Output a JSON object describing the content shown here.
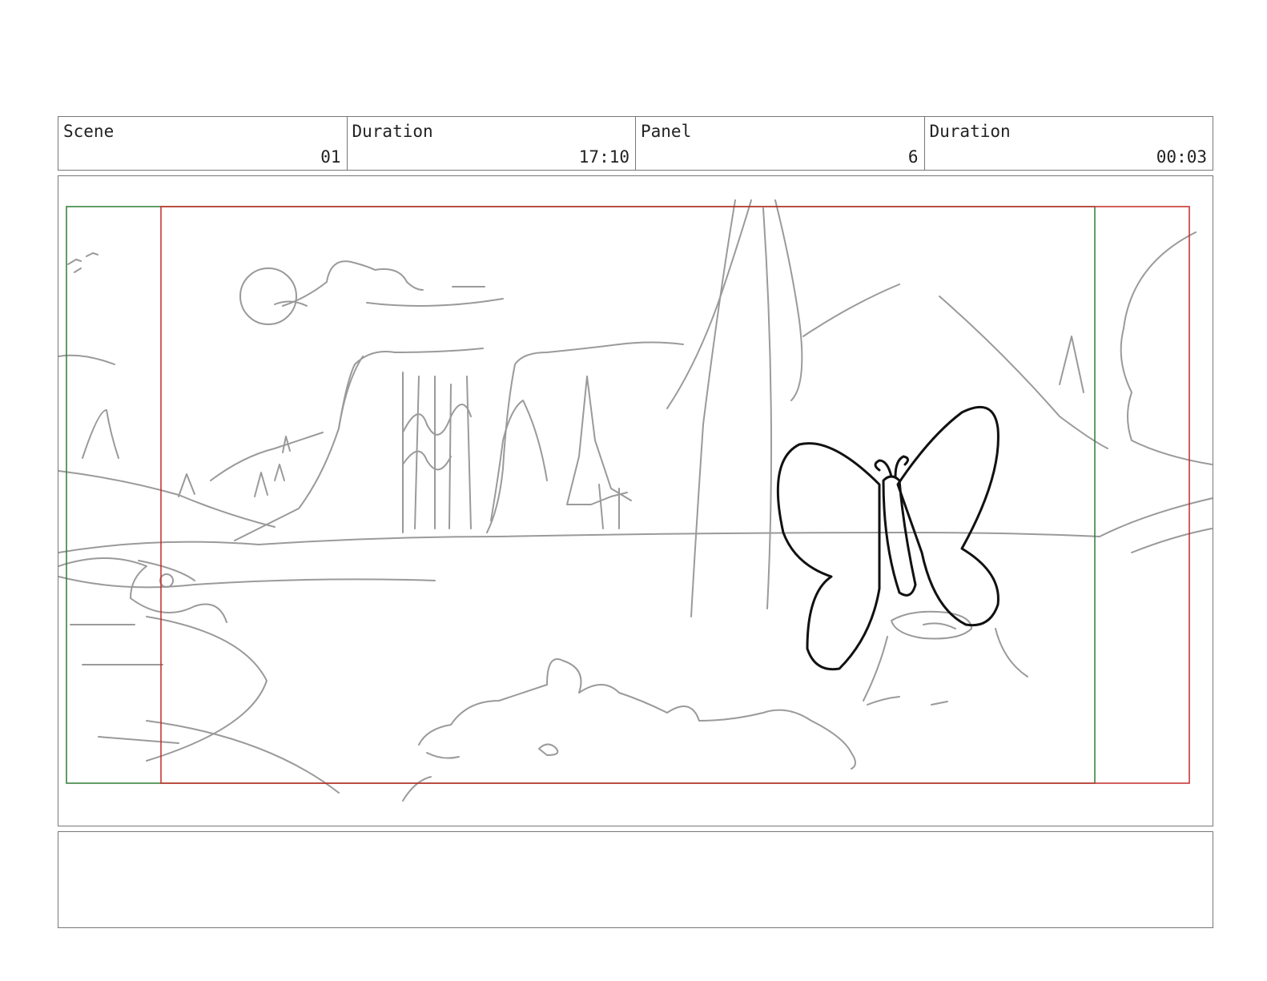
{
  "header": {
    "scene": {
      "label": "Scene",
      "value": "01"
    },
    "duration_total": {
      "label": "Duration",
      "value": "17:10"
    },
    "panel": {
      "label": "Panel",
      "value": "6"
    },
    "duration_panel": {
      "label": "Duration",
      "value": "00:03"
    }
  },
  "frame_colors": {
    "safe_frame": "#2e7d32",
    "camera_frame": "#c62828",
    "sketch": "#999999",
    "character": "#111111"
  },
  "notes": {
    "text": ""
  }
}
